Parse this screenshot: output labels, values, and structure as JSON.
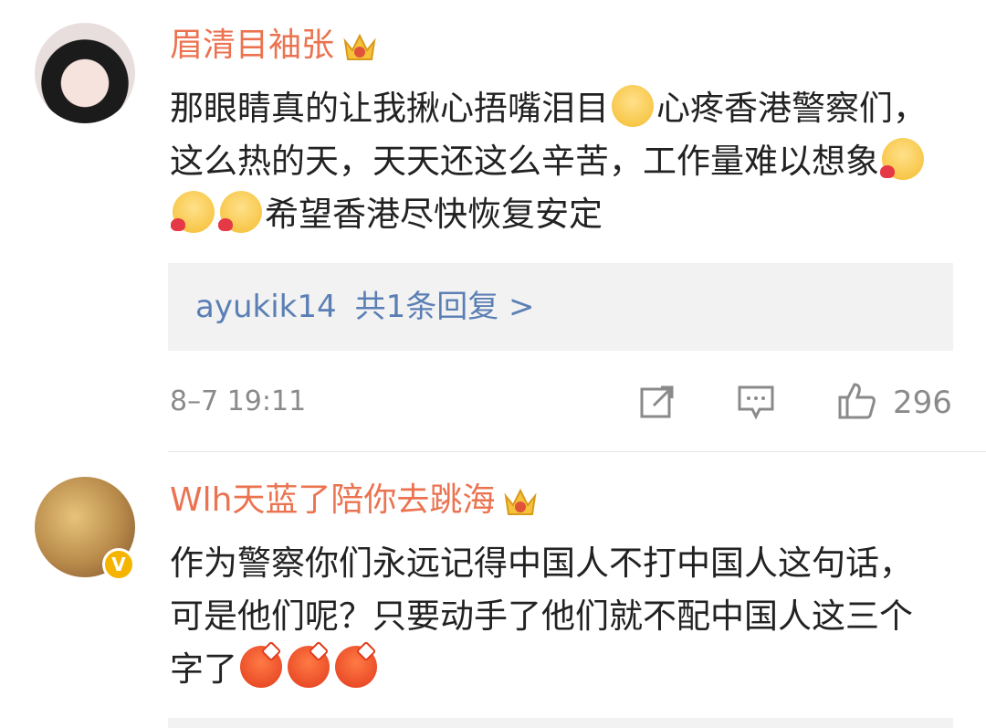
{
  "comments": [
    {
      "username": "眉清目袖张",
      "vip_icon": "vip-crown-icon",
      "text_parts": [
        "那眼睛真的让我揪心捂嘴泪目",
        "心疼香港警察们，这么热的天，天天还这么辛苦，工作量难以想象",
        "希望香港尽快恢复安定"
      ],
      "reply": {
        "user": "ayukik14",
        "summary": "共1条回复 >"
      },
      "timestamp": "8–7 19:11",
      "likes": "296"
    },
    {
      "username": "Wlh天蓝了陪你去跳海",
      "vip_icon": "vip-crown-icon",
      "verified_badge": "V",
      "text_parts": [
        "作为警察你们永远记得中国人不打中国人这句话，可是他们呢？只要动手了他们就不配中国人这三个字了"
      ]
    }
  ],
  "colors": {
    "username": "#eb7350",
    "link": "#5b7fb5",
    "meta": "#8a8a8a"
  }
}
